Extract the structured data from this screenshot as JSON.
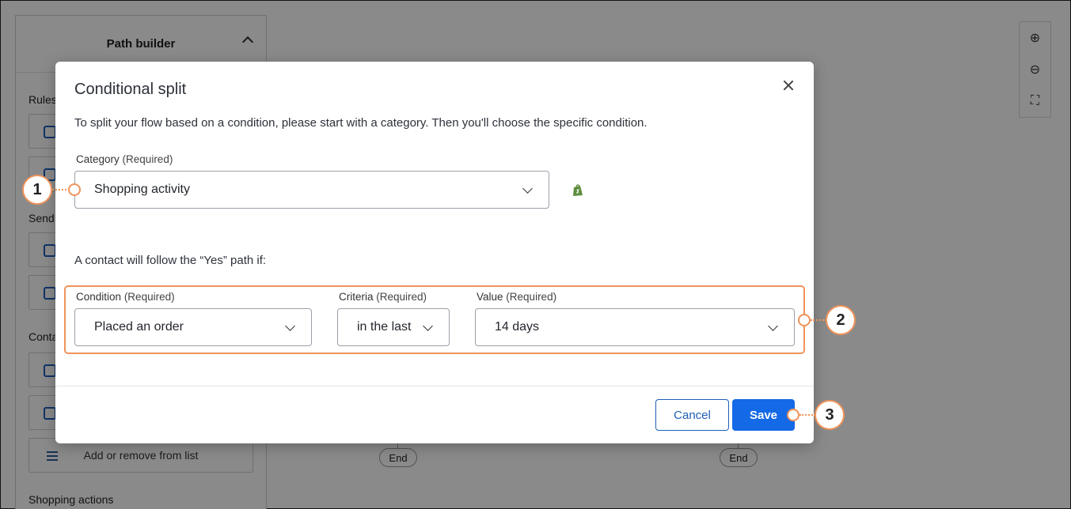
{
  "sidebar": {
    "title": "Path builder",
    "sections": {
      "rules": "Rules",
      "send": "Send",
      "contacts": "Conta",
      "shopping": "Shopping actions"
    },
    "list_tile": "Add or remove from list"
  },
  "canvas": {
    "end_label_left": "End",
    "end_label_right": "End",
    "zoom_in_icon": "zoom-in-icon",
    "zoom_out_icon": "zoom-out-icon",
    "fit_icon": "fit-screen-icon"
  },
  "modal": {
    "title": "Conditional split",
    "intro": "To split your flow based on a condition, please start with a category. Then you'll choose the specific condition.",
    "category": {
      "label": "Category",
      "required": "(Required)",
      "value": "Shopping activity"
    },
    "follow_text": "A contact will follow the “Yes” path if:",
    "condition": {
      "label": "Condition",
      "required": "(Required)",
      "value": "Placed an order"
    },
    "criteria": {
      "label": "Criteria",
      "required": "(Required)",
      "value": "in the last"
    },
    "value_field": {
      "label": "Value",
      "required": "(Required)",
      "value": "14 days"
    },
    "cancel_label": "Cancel",
    "save_label": "Save"
  },
  "callouts": [
    "1",
    "2",
    "3"
  ],
  "colors": {
    "accent": "#1469e6",
    "callout": "#f0935a",
    "outline_button": "#1f5fb5"
  }
}
